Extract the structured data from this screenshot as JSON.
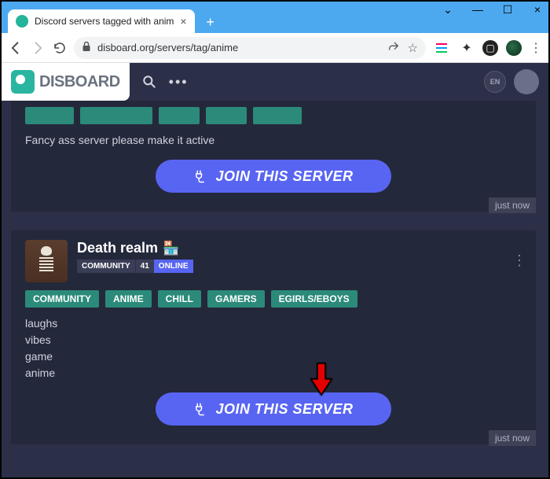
{
  "browser": {
    "tab_title": "Discord servers tagged with anim",
    "url": "disboard.org/servers/tag/anime"
  },
  "disboard": {
    "logo_text": "DISBOARD",
    "lang": "EN"
  },
  "cards": [
    {
      "stub_tag_widths": [
        62,
        92,
        52,
        52,
        62
      ],
      "desc": "Fancy ass server please make it active",
      "join_label": "JOIN THIS SERVER",
      "timestamp": "just now"
    },
    {
      "name": "Death realm",
      "emoji": "🏪",
      "category": "COMMUNITY",
      "member_count": "41",
      "status": "ONLINE",
      "tags": [
        "COMMUNITY",
        "ANIME",
        "CHILL",
        "GAMERS",
        "EGIRLS/EBOYS"
      ],
      "desc": "laughs\nvibes\ngame\nanime",
      "join_label": "JOIN THIS SERVER",
      "timestamp": "just now"
    }
  ]
}
